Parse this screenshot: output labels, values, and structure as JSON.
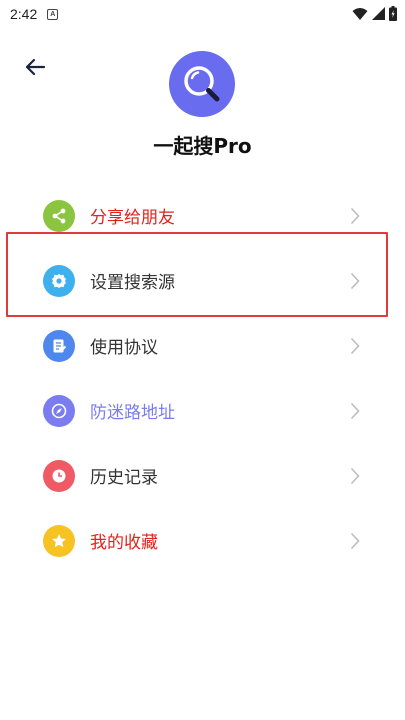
{
  "status_bar": {
    "time": "2:42",
    "notification_glyph": "A"
  },
  "header": {
    "app_name": "一起搜Pro"
  },
  "menu": {
    "items": [
      {
        "label": "分享给朋友",
        "icon": "share-icon",
        "icon_color": "#8bc53f",
        "label_color": "#e2231a"
      },
      {
        "label": "设置搜索源",
        "icon": "settings-icon",
        "icon_color": "#3fb0ee",
        "label_color": "#333333"
      },
      {
        "label": "使用协议",
        "icon": "document-icon",
        "icon_color": "#4f88ec",
        "label_color": "#333333"
      },
      {
        "label": "防迷路地址",
        "icon": "compass-icon",
        "icon_color": "#7a7cf0",
        "label_color": "#7a7cf0"
      },
      {
        "label": "历史记录",
        "icon": "clock-icon",
        "icon_color": "#ef5a65",
        "label_color": "#333333"
      },
      {
        "label": "我的收藏",
        "icon": "star-icon",
        "icon_color": "#f6c323",
        "label_color": "#e2231a"
      }
    ]
  },
  "colors": {
    "brand": "#6a6cf0",
    "highlight_border": "#e23a3a"
  }
}
